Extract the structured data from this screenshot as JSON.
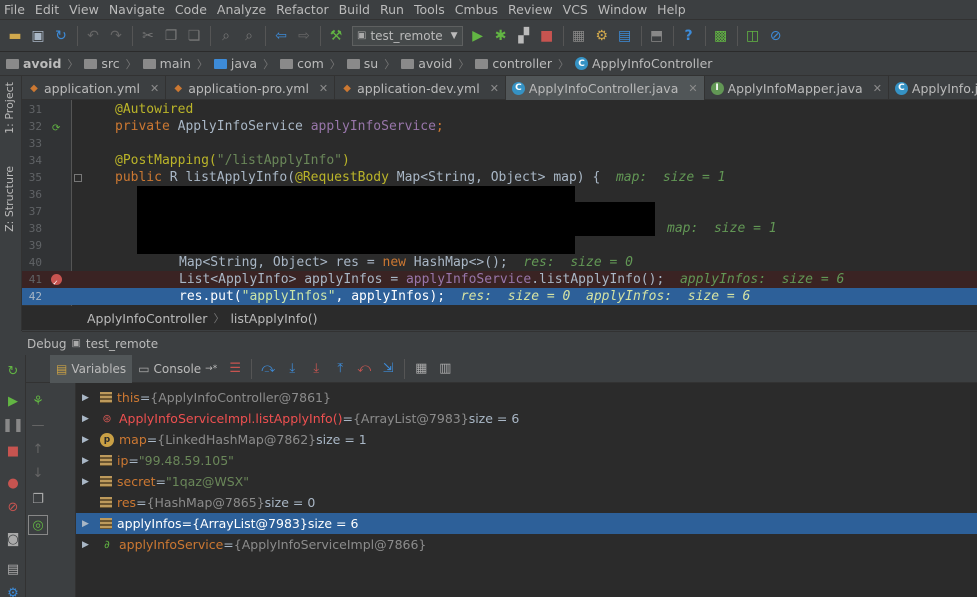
{
  "menu": [
    "File",
    "Edit",
    "View",
    "Navigate",
    "Code",
    "Analyze",
    "Refactor",
    "Build",
    "Run",
    "Tools",
    "Cmbus",
    "Review",
    "VCS",
    "Window",
    "Help"
  ],
  "toolbar": {
    "run_config": "test_remote"
  },
  "navbar": {
    "crumbs": [
      "avoid",
      "src",
      "main",
      "java",
      "com",
      "su",
      "avoid",
      "controller",
      "ApplyInfoController"
    ]
  },
  "sidebar": {
    "project_tab": "1: Project",
    "structure_tab": "Z: Structure"
  },
  "tabs": [
    {
      "label": "application.yml",
      "icon": "yml-icon"
    },
    {
      "label": "application-pro.yml",
      "icon": "yml-icon"
    },
    {
      "label": "application-dev.yml",
      "icon": "yml-icon"
    },
    {
      "label": "ApplyInfoController.java",
      "icon": "class-icon",
      "active": true
    },
    {
      "label": "ApplyInfoMapper.java",
      "icon": "interface-icon"
    },
    {
      "label": "ApplyInfo.java",
      "icon": "class-icon"
    }
  ],
  "editor": {
    "line_numbers": [
      "31",
      "32",
      "33",
      "34",
      "35",
      "36",
      "37",
      "38",
      "39",
      "40",
      "41",
      "42"
    ],
    "l31": {
      "annotation": "@Autowired"
    },
    "l32": {
      "kw": "private",
      "type": " ApplyInfoService ",
      "field": "applyInfoService",
      "end": ";"
    },
    "l34": {
      "annotation": "@PostMapping(",
      "str": "\"/listApplyInfo\"",
      "end": ")"
    },
    "l35": {
      "kw": "public",
      "code": " R listApplyInfo(",
      "ann": "@RequestBody",
      "rest": " Map<String, Object> map) {",
      "inline": "map:  size = 1"
    },
    "l38": {
      "inline": "map:  size = 1"
    },
    "l40": {
      "code": "Map<String, Object> res = ",
      "kw": "new",
      "rest": " HashMap<>();",
      "inline": "res:  size = 0"
    },
    "l41": {
      "code": "List<ApplyInfo> applyInfos = ",
      "field": "applyInfoService",
      "rest": ".listApplyInfo();",
      "inline": "applyInfos:  size = 6"
    },
    "l42": {
      "code": "res.put(",
      "str": "\"applyInfos\"",
      "rest": ", applyInfos);",
      "inline": "res:  size = 0  applyInfos:  size = 6"
    }
  },
  "code_breadcrumb": {
    "cls": "ApplyInfoController",
    "method": "listApplyInfo()"
  },
  "debug": {
    "title": "Debug",
    "session": "test_remote",
    "tab_variables": "Variables",
    "tab_console": "Console"
  },
  "variables": [
    {
      "name": "this",
      "eq": " = ",
      "type": "{ApplyInfoController@7861}",
      "extra": "",
      "icon": "field",
      "red": false
    },
    {
      "name": "ApplyInfoServiceImpl.listApplyInfo()",
      "eq": " = ",
      "type": "{ArrayList@7983}",
      "extra": "  size = 6",
      "icon": "return",
      "red": true
    },
    {
      "name": "map",
      "eq": " = ",
      "type": "{LinkedHashMap@7862}",
      "extra": "  size = 1",
      "icon": "param",
      "red": false
    },
    {
      "name": "ip",
      "eq": " = ",
      "type": "",
      "str": "\"99.48.59.105\"",
      "extra": "",
      "icon": "field",
      "red": false
    },
    {
      "name": "secret",
      "eq": " = ",
      "type": "",
      "str": "\"1qaz@WSX\"",
      "extra": "",
      "icon": "field",
      "red": false
    },
    {
      "name": "res",
      "eq": " = ",
      "type": "{HashMap@7865}",
      "extra": "  size = 0",
      "icon": "field",
      "red": false
    },
    {
      "name": "applyInfos",
      "eq": " = ",
      "type": "{ArrayList@7983}",
      "extra": "  size = 6",
      "icon": "field",
      "red": false,
      "selected": true
    },
    {
      "name": "applyInfoService",
      "eq": " = ",
      "type": "{ApplyInfoServiceImpl@7866}",
      "extra": "",
      "icon": "service",
      "red": false
    }
  ],
  "colors": {
    "selection": "#2d6099",
    "breakpoint": "#c75450",
    "keyword": "#cc7832",
    "string": "#6a8759",
    "field": "#9876aa",
    "annotation": "#bbb529"
  }
}
